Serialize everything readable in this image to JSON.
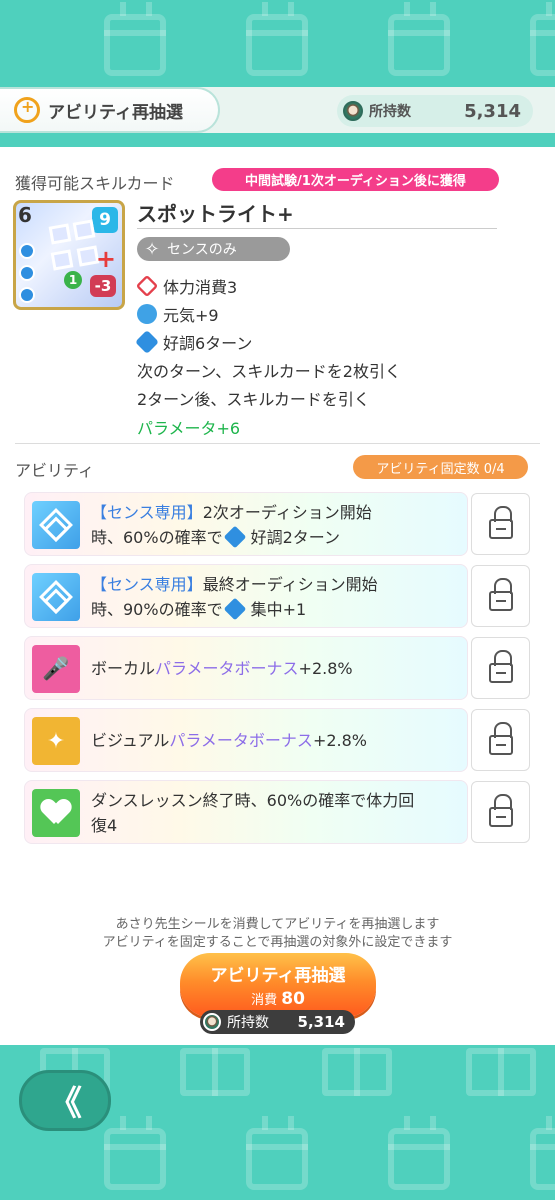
{
  "header": {
    "redraw_tab_label": "アビリティ再抽選",
    "owned_label": "所持数",
    "owned_value": "5,314"
  },
  "skill_section": {
    "title": "獲得可能スキルカード",
    "badge": "中間試験/1次オーディション後に獲得"
  },
  "card": {
    "cost": "6",
    "shield": "9",
    "stamina_cost_badge": "-3",
    "level_badge": "1",
    "name": "スポットライト+",
    "tag": "センスのみ",
    "effects": [
      {
        "icon": "stamina-icon",
        "text": "体力消費3"
      },
      {
        "icon": "vigor-icon",
        "text": "元気+9"
      },
      {
        "icon": "good-condition-icon",
        "text": "好調6ターン"
      }
    ],
    "plain_lines": [
      "次のターン、スキルカードを2枚引く",
      "2ターン後、スキルカードを引く"
    ],
    "param_line": "パラメータ+6"
  },
  "ability_section": {
    "title": "アビリティ",
    "fixed_count": "アビリティ固定数 0/4",
    "items": [
      {
        "icon": "sense-icon",
        "prefix": "【センス専用】",
        "line1_rest": "2次オーディション開始",
        "line2_a": "時、60%の確率で",
        "line2_effect": "好調2ターン"
      },
      {
        "icon": "sense-icon",
        "prefix": "【センス専用】",
        "line1_rest": "最終オーディション開始",
        "line2_a": "時、90%の確率で",
        "line2_effect": "集中+1"
      },
      {
        "icon": "vocal-icon",
        "pre": "ボーカル",
        "hl": "パラメータボーナス",
        "post": "+2.8%"
      },
      {
        "icon": "visual-icon",
        "pre": "ビジュアル",
        "hl": "パラメータボーナス",
        "post": "+2.8%"
      },
      {
        "icon": "heart-icon",
        "line1": "ダンスレッスン終了時、60%の確率で体力回",
        "line2": "復4"
      }
    ]
  },
  "footer": {
    "info_line1": "あさり先生シールを消費してアビリティを再抽選します",
    "info_line2": "アビリティを固定することで再抽選の対象外に設定できます",
    "button_label": "アビリティ再抽選",
    "cost_label": "消費",
    "cost_value": "80",
    "owned_label": "所持数",
    "owned_value": "5,314",
    "back_label": "《"
  },
  "colors": {
    "background": "#4fd0bd",
    "badge_pink": "#f43d8a",
    "badge_orange": "#f49a48",
    "button_orange": "#ff8c2a",
    "param_green": "#1eb54c"
  }
}
